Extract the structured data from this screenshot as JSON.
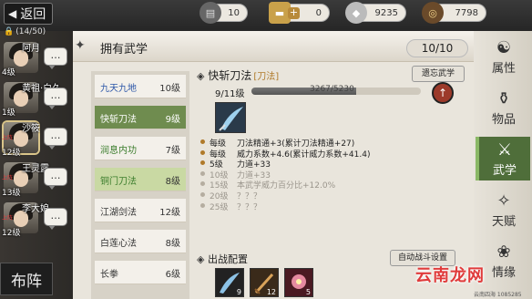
{
  "topbar": {
    "back_label": "返回",
    "resources": [
      {
        "name": "bandage",
        "icon": "bandage-icon",
        "value": "10"
      },
      {
        "name": "gold",
        "icon": "gold-bar-icon",
        "value": "0"
      },
      {
        "name": "silver",
        "icon": "silver-icon",
        "value": "9235"
      },
      {
        "name": "coin",
        "icon": "coin-icon",
        "value": "7798"
      }
    ]
  },
  "party": {
    "count": "(14/50)",
    "members": [
      {
        "name": "阿月",
        "level": "4级",
        "tag": ""
      },
      {
        "name": "黄祖·白久",
        "level": "1级",
        "tag": ""
      },
      {
        "name": "沙筱",
        "level": "12级",
        "tag": "上阵"
      },
      {
        "name": "王灵露",
        "level": "13级",
        "tag": "上阵"
      },
      {
        "name": "李大娘",
        "level": "12级",
        "tag": "上阵"
      }
    ],
    "formation_label": "布阵",
    "bubble_label": "…"
  },
  "panel": {
    "title": "拥有武学",
    "count": "10/10"
  },
  "skills": [
    {
      "name": "九天九地",
      "level": "10级"
    },
    {
      "name": "快斩刀法",
      "level": "9级"
    },
    {
      "name": "润息内功",
      "level": "7级"
    },
    {
      "name": "铜门刀法",
      "level": "8级"
    },
    {
      "name": "江湖剑法",
      "level": "12级"
    },
    {
      "name": "白莲心法",
      "level": "8级"
    },
    {
      "name": "长拳",
      "level": "6级"
    }
  ],
  "detail": {
    "name": "快斩刀法",
    "type": "[刀法]",
    "forget_label": "遗忘武学",
    "level_text": "9/11级",
    "xp_text": "3267/5230",
    "xp_progress": 0.62,
    "up_label": "↑",
    "effects": [
      {
        "lv": "每级",
        "text": "刀法精通+3(累计刀法精通+27)",
        "active": true
      },
      {
        "lv": "每级",
        "text": "威力系数+4.6(累计威力系数+41.4)",
        "active": true
      },
      {
        "lv": "5级",
        "text": "力道+33",
        "active": true
      },
      {
        "lv": "10级",
        "text": "力道+33",
        "active": false
      },
      {
        "lv": "15级",
        "text": "本武学威力百分比+12.0%",
        "active": false
      },
      {
        "lv": "20级",
        "text": "？？？",
        "active": false
      },
      {
        "lv": "25级",
        "text": "？？？",
        "active": false
      }
    ],
    "battle_title": "出战配置",
    "auto_label": "自动战斗设置",
    "slots": [
      {
        "icon": "blade-slash-icon",
        "count": "9"
      },
      {
        "icon": "sword-icon",
        "count": "12"
      },
      {
        "icon": "flower-icon",
        "count": "5"
      }
    ]
  },
  "tabs": [
    {
      "label": "属性",
      "icon": "attribute-icon"
    },
    {
      "label": "物品",
      "icon": "item-icon"
    },
    {
      "label": "武学",
      "icon": "martial-icon"
    },
    {
      "label": "天赋",
      "icon": "talent-icon"
    },
    {
      "label": "情缘",
      "icon": "affinity-icon"
    }
  ],
  "watermark": "云南龙网",
  "watermark_sub": "云南四海 1085285"
}
